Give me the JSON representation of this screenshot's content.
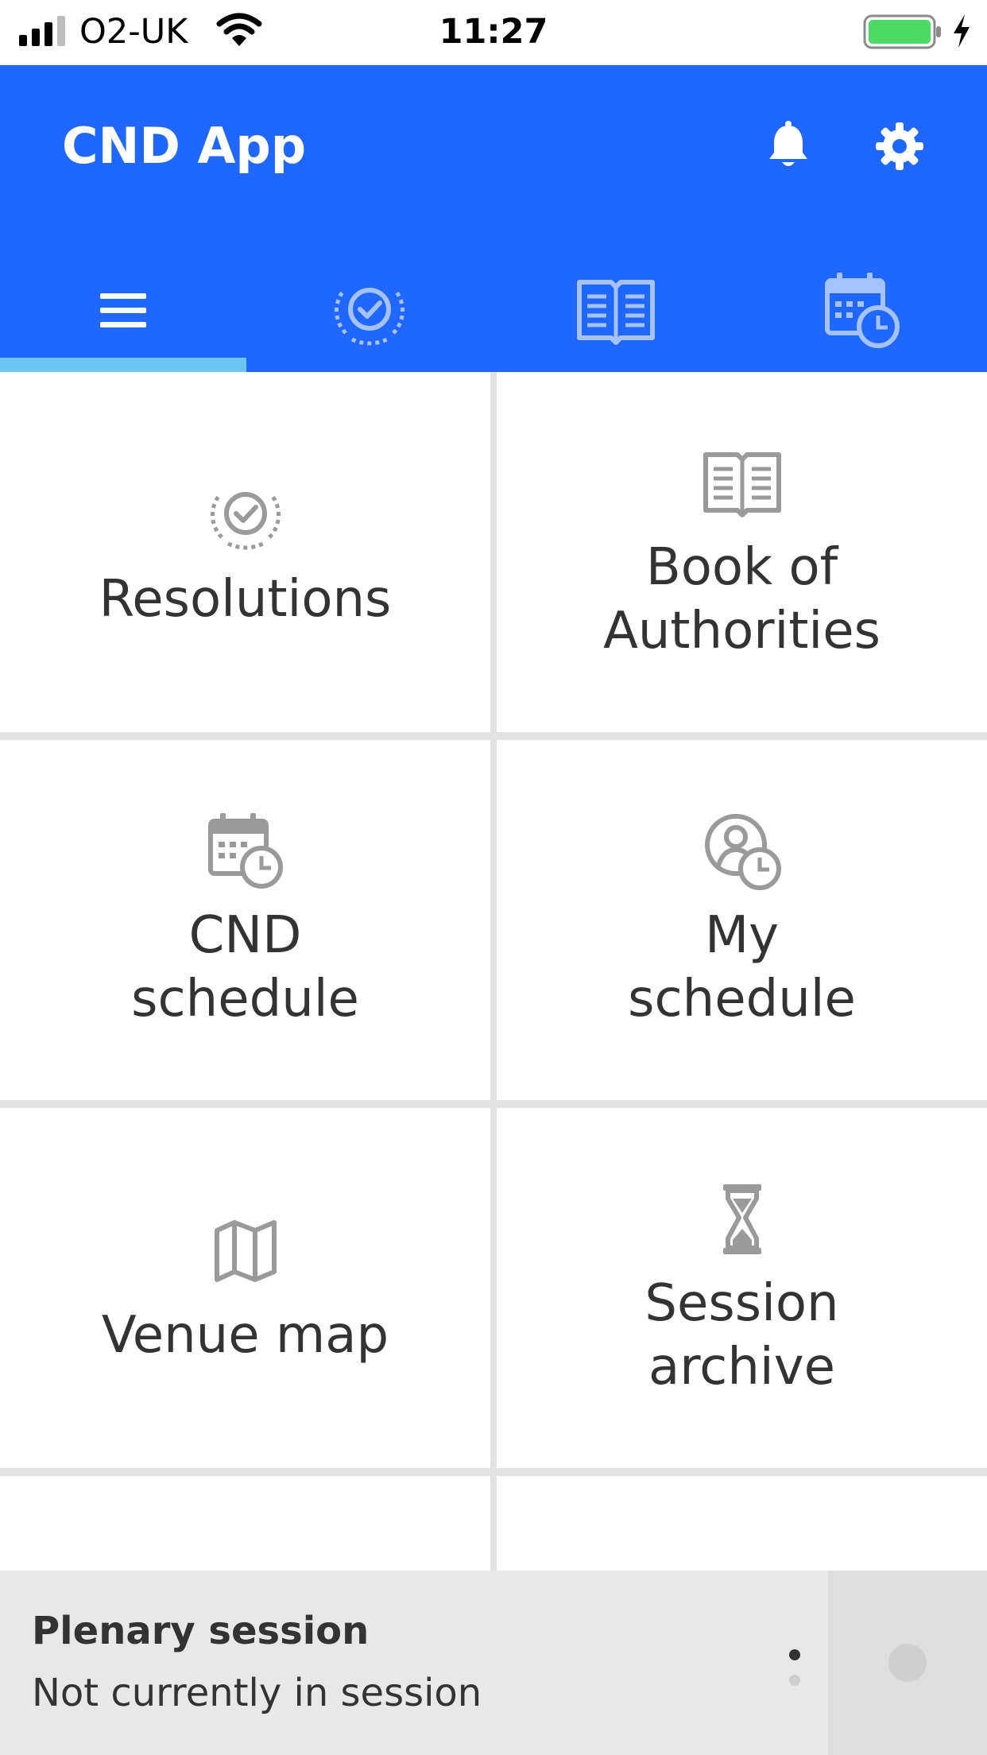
{
  "status_bar": {
    "carrier": "O2-UK",
    "time": "11:27",
    "battery_color": "#4cd964"
  },
  "header": {
    "title": "CND App",
    "bell_icon": "bell-icon",
    "settings_icon": "gear-icon",
    "color": "#1f67ff"
  },
  "tabs": [
    {
      "icon": "menu-icon",
      "selected": true
    },
    {
      "icon": "laurel-check-icon",
      "selected": false
    },
    {
      "icon": "open-book-icon",
      "selected": false
    },
    {
      "icon": "calendar-clock-icon",
      "selected": false
    }
  ],
  "tiles": [
    {
      "label": "Resolutions",
      "icon": "laurel-check-icon"
    },
    {
      "label": "Book of\nAuthorities",
      "icon": "open-book-icon"
    },
    {
      "label": "CND\nschedule",
      "icon": "calendar-clock-icon"
    },
    {
      "label": "My\nschedule",
      "icon": "user-clock-icon"
    },
    {
      "label": "Venue map",
      "icon": "map-icon"
    },
    {
      "label": "Session\narchive",
      "icon": "hourglass-icon"
    }
  ],
  "session": {
    "title": "Plenary session",
    "subtitle": "Not currently in session"
  }
}
